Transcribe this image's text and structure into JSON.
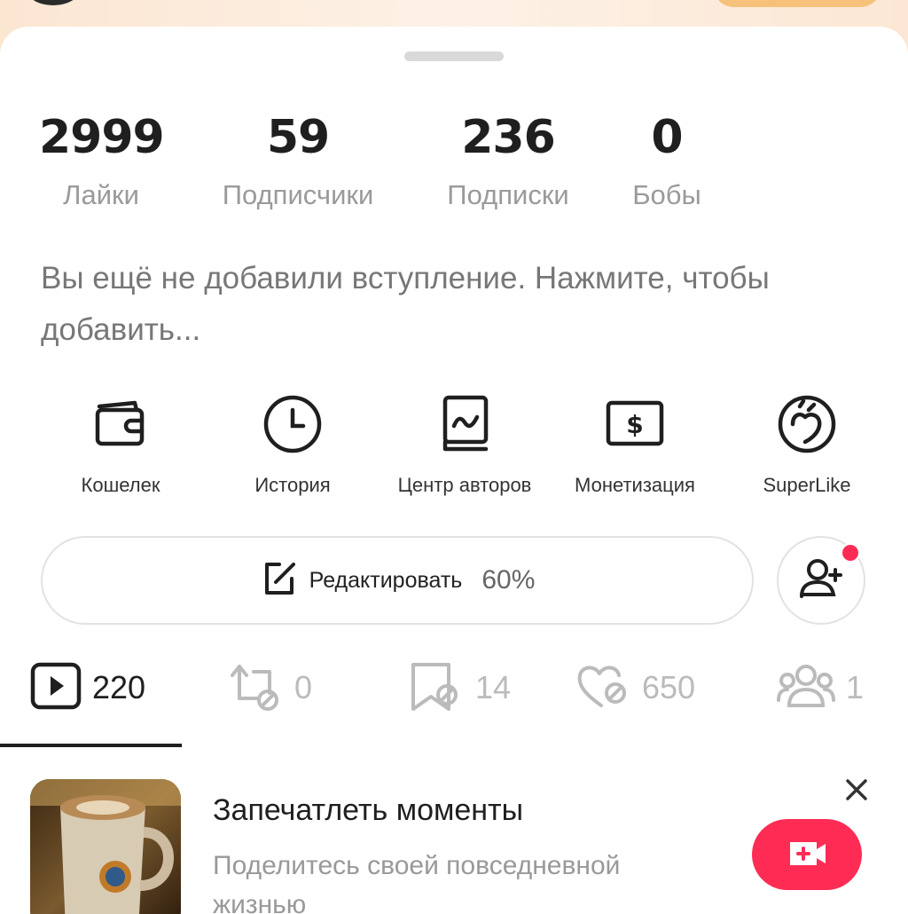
{
  "stats": [
    {
      "value": "2999",
      "label": "Лайки"
    },
    {
      "value": "59",
      "label": "Подписчики"
    },
    {
      "value": "236",
      "label": "Подписки"
    },
    {
      "value": "0",
      "label": "Бобы"
    }
  ],
  "bio": "Вы ещё не добавили вступление. Нажмите, чтобы добавить...",
  "tools": [
    {
      "label": "Кошелек",
      "icon": "wallet-icon"
    },
    {
      "label": "История",
      "icon": "clock-icon"
    },
    {
      "label": "Центр авторов",
      "icon": "creator-center-icon"
    },
    {
      "label": "Монетизация",
      "icon": "dollar-icon"
    },
    {
      "label": "SuperLike",
      "icon": "superlike-icon"
    }
  ],
  "edit": {
    "label": "Редактировать",
    "percent": "60%",
    "icon": "edit-icon"
  },
  "add_friend": {
    "icon": "add-friend-icon",
    "has_notification": true
  },
  "tabs": [
    {
      "icon": "video-play-icon",
      "count": "220",
      "active": true
    },
    {
      "icon": "repost-icon",
      "count": "0"
    },
    {
      "icon": "bookmark-icon",
      "count": "14"
    },
    {
      "icon": "heart-hidden-icon",
      "count": "650"
    },
    {
      "icon": "friends-icon",
      "count": "1"
    }
  ],
  "promo": {
    "title": "Запечатлеть моменты",
    "subtitle": "Поделитесь своей повседневной жизнью",
    "close_icon": "close-icon",
    "button_icon": "camera-plus-icon"
  },
  "colors": {
    "accent": "#fe2c55",
    "text_primary": "#1f1f1f",
    "text_secondary": "#9a9a9a",
    "header_gradient": "#fbe6d2"
  }
}
